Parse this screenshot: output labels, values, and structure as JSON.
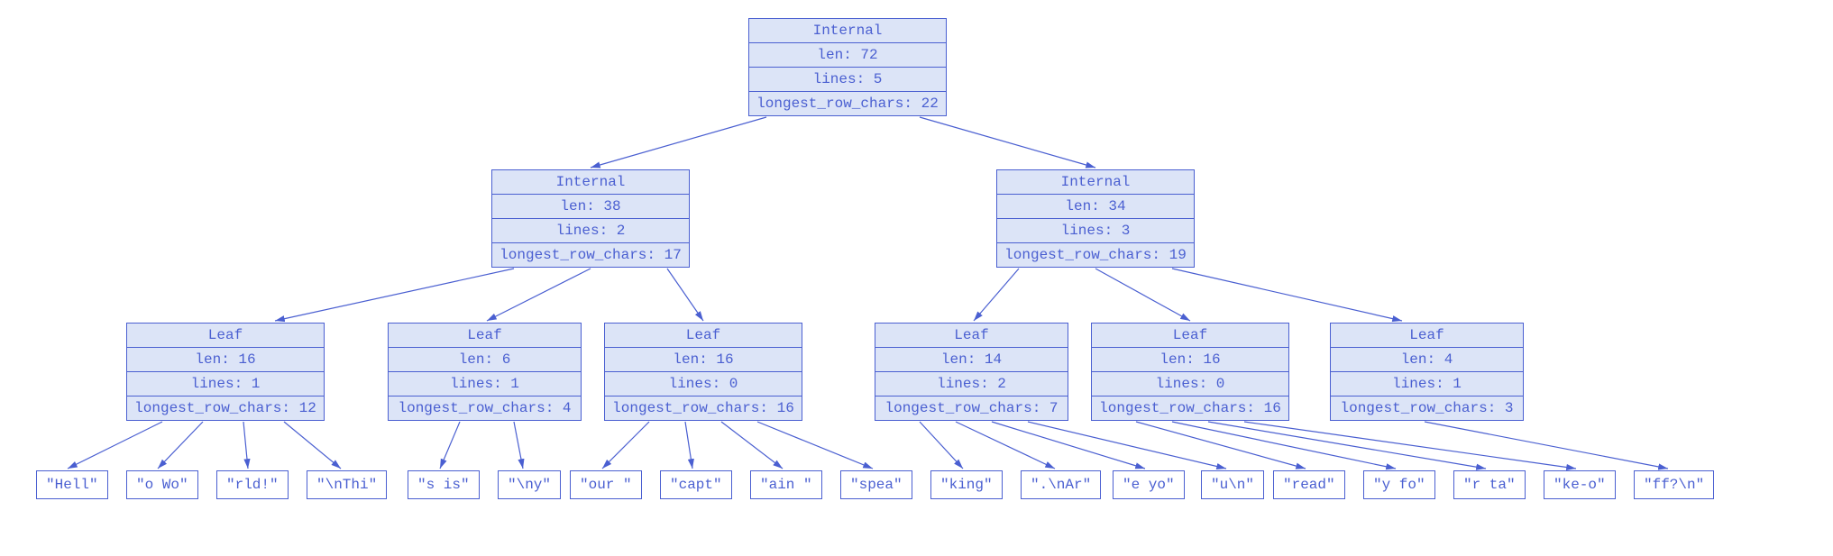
{
  "root": {
    "type": "Internal",
    "len": "len: 72",
    "lines": "lines: 5",
    "longest": "longest_row_chars: 22"
  },
  "left": {
    "type": "Internal",
    "len": "len: 38",
    "lines": "lines: 2",
    "longest": "longest_row_chars: 17"
  },
  "right": {
    "type": "Internal",
    "len": "len: 34",
    "lines": "lines: 3",
    "longest": "longest_row_chars: 19"
  },
  "leaf1": {
    "type": "Leaf",
    "len": "len: 16",
    "lines": "lines: 1",
    "longest": "longest_row_chars: 12"
  },
  "leaf2": {
    "type": "Leaf",
    "len": "len: 6",
    "lines": "lines: 1",
    "longest": "longest_row_chars: 4"
  },
  "leaf3": {
    "type": "Leaf",
    "len": "len: 16",
    "lines": "lines: 0",
    "longest": "longest_row_chars: 16"
  },
  "leaf4": {
    "type": "Leaf",
    "len": "len: 14",
    "lines": "lines: 2",
    "longest": "longest_row_chars: 7"
  },
  "leaf5": {
    "type": "Leaf",
    "len": "len: 16",
    "lines": "lines: 0",
    "longest": "longest_row_chars: 16"
  },
  "leaf6": {
    "type": "Leaf",
    "len": "len: 4",
    "lines": "lines: 1",
    "longest": "longest_row_chars: 3"
  },
  "chunks": {
    "c1": "\"Hell\"",
    "c2": "\"o Wo\"",
    "c3": "\"rld!\"",
    "c4": "\"\\nThi\"",
    "c5": "\"s is\"",
    "c6": "\"\\ny\"",
    "c7": "\"our \"",
    "c8": "\"capt\"",
    "c9": "\"ain \"",
    "c10": "\"spea\"",
    "c11": "\"king\"",
    "c12": "\".\\nAr\"",
    "c13": "\"e yo\"",
    "c14": "\"u\\n\"",
    "c15": "\"read\"",
    "c16": "\"y fo\"",
    "c17": "\"r ta\"",
    "c18": "\"ke-o\"",
    "c19": "\"ff?\\n\""
  }
}
